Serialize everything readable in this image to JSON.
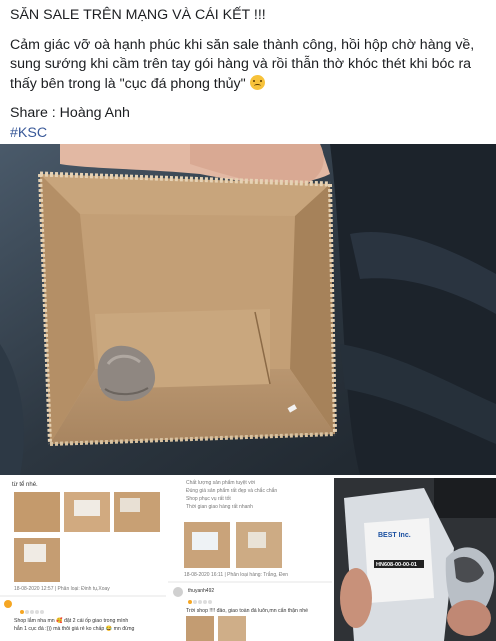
{
  "post": {
    "title": "SĂN SALE TRÊN MẠNG VÀ CÁI KẾT !!!",
    "body": "Cảm giác vỡ oà hạnh phúc khi săn sale thành công, hồi hộp chờ hàng về, sung sướng khi cầm trên tay gói hàng và rồi thẫn thờ khóc thét khi bóc ra thấy bên trong là \"cục đá phong thủy\"",
    "emoji_icon": "sad-face-emoji",
    "share": "Share : Hoàng Anh",
    "hashtag": "#KSC"
  },
  "screenshot_left": {
    "line1": "từ tể nhé.",
    "timestamp1": "18-08-2020 12:57 | Phân loại: Đinh tụ,Xoay",
    "line2": "Shop  lắm nha mn 🥰 đặt 2 cái ốp giao trong mình",
    "line3": "hẳn 1 cục đá :))) mà thôi giá rẻ ko chấp 😂 mn đừng"
  },
  "screenshot_middle": {
    "line1": "Chất lượng sản phẩm tuyệt vời",
    "line2": "Đúng giá sản phẩm rất đẹp và chắc chắn",
    "line3": "Shop phục vụ rất tốt",
    "line4": "Thời gian giao hàng rất nhanh",
    "timestamp": "18-08-2020 16:11 | Phân loại hàng: Trắng, Đen",
    "user": "thuyanh492",
    "line5": "Trời shop !!!! đảo, giao toàn đá luôn,mn cẩn thận nhé"
  },
  "screenshot_right": {
    "brand": "BEST Inc.",
    "label_code": "HN608-00-00-01"
  }
}
